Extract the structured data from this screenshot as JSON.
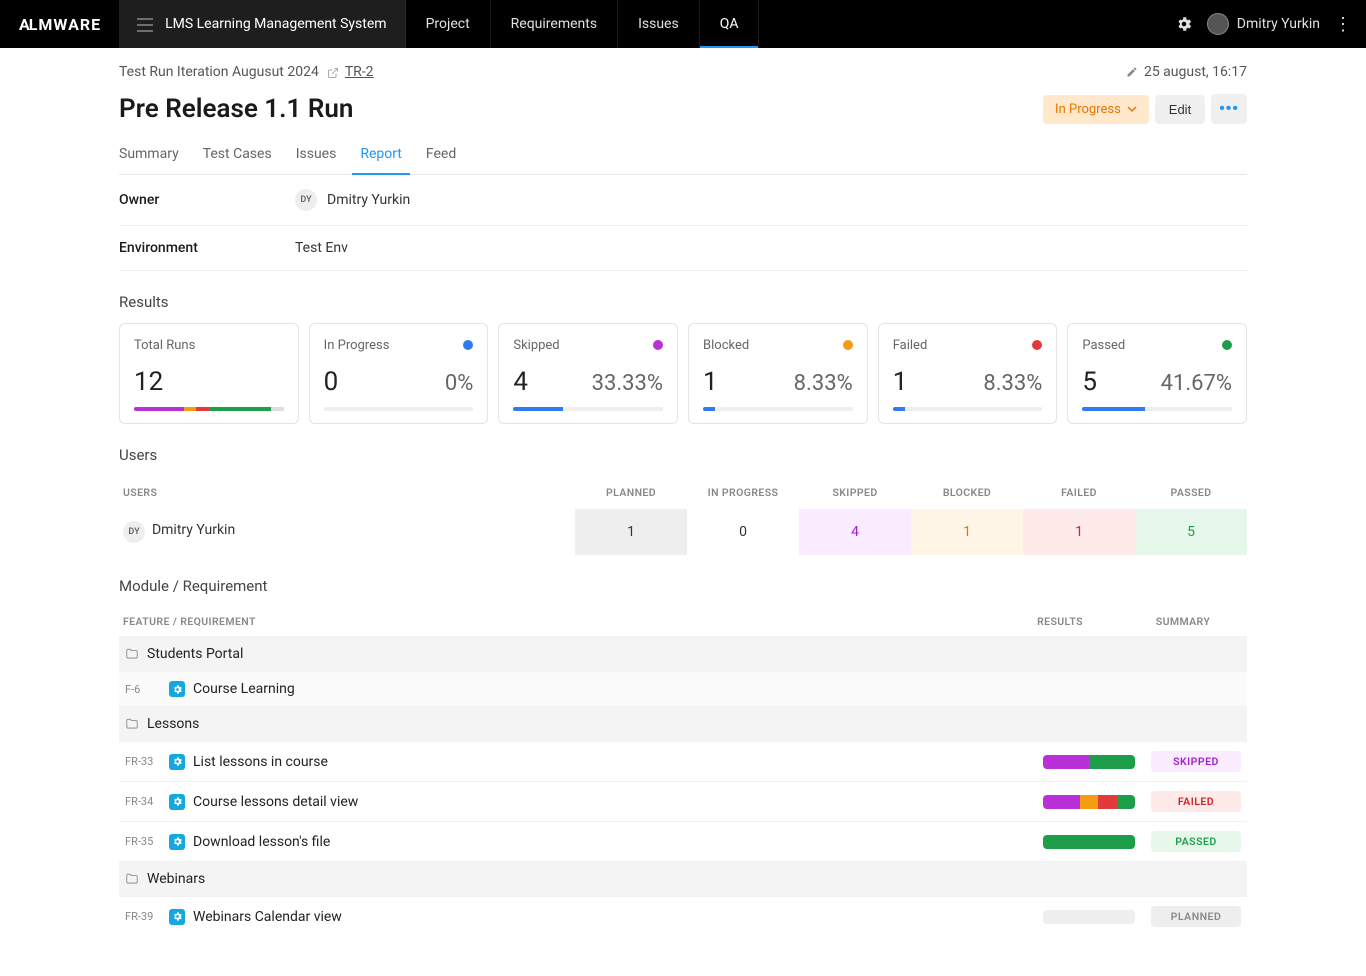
{
  "colors": {
    "inprogress": "#2f7bf3",
    "skipped": "#b930d8",
    "blocked": "#f39c12",
    "failed": "#e23a3a",
    "passed": "#1f9e4a",
    "planned": "#dddddd"
  },
  "nav": {
    "logo": "ALMWARE",
    "project_selector": "LMS Learning Management System",
    "items": [
      "Project",
      "Requirements",
      "Issues",
      "QA"
    ],
    "active_index": 3,
    "user_name": "Dmitry Yurkin"
  },
  "breadcrumb": {
    "text": "Test Run Iteration Augusut 2024",
    "id": "TR-2",
    "date": "25 august, 16:17"
  },
  "header": {
    "title": "Pre Release 1.1 Run",
    "status": "In Progress",
    "edit": "Edit"
  },
  "tabs": {
    "items": [
      "Summary",
      "Test Cases",
      "Issues",
      "Report",
      "Feed"
    ],
    "active_index": 3
  },
  "details": {
    "owner_label": "Owner",
    "owner_initials": "DY",
    "owner_name": "Dmitry Yurkin",
    "env_label": "Environment",
    "env_value": "Test Env"
  },
  "sections": {
    "results": "Results",
    "users": "Users",
    "module": "Module / Requirement"
  },
  "result_cards": [
    {
      "key": "total",
      "label": "Total Runs",
      "value": "12",
      "percent": "",
      "dot": "",
      "bar": [
        [
          "#b930d8",
          33.33
        ],
        [
          "#f39c12",
          8.33
        ],
        [
          "#e23a3a",
          8.33
        ],
        [
          "#1f9e4a",
          41.67
        ],
        [
          "#dddddd",
          8.34
        ]
      ]
    },
    {
      "key": "inprogress",
      "label": "In Progress",
      "value": "0",
      "percent": "0%",
      "dot": "#2f7bf3",
      "bar": [
        [
          "#2f7bf3",
          0
        ],
        [
          "#eeeeee",
          100
        ]
      ]
    },
    {
      "key": "skipped",
      "label": "Skipped",
      "value": "4",
      "percent": "33.33%",
      "dot": "#b930d8",
      "bar": [
        [
          "#2f7bf3",
          33.33
        ],
        [
          "#eeeeee",
          66.67
        ]
      ]
    },
    {
      "key": "blocked",
      "label": "Blocked",
      "value": "1",
      "percent": "8.33%",
      "dot": "#f39c12",
      "bar": [
        [
          "#2f7bf3",
          8.33
        ],
        [
          "#eeeeee",
          91.67
        ]
      ]
    },
    {
      "key": "failed",
      "label": "Failed",
      "value": "1",
      "percent": "8.33%",
      "dot": "#e23a3a",
      "bar": [
        [
          "#2f7bf3",
          8.33
        ],
        [
          "#eeeeee",
          91.67
        ]
      ]
    },
    {
      "key": "passed",
      "label": "Passed",
      "value": "5",
      "percent": "41.67%",
      "dot": "#1f9e4a",
      "bar": [
        [
          "#2f7bf3",
          41.67
        ],
        [
          "#eeeeee",
          58.33
        ]
      ]
    }
  ],
  "users": {
    "columns": [
      "USERS",
      "PLANNED",
      "IN PROGRESS",
      "SKIPPED",
      "BLOCKED",
      "FAILED",
      "PASSED"
    ],
    "rows": [
      {
        "initials": "DY",
        "name": "Dmitry Yurkin",
        "planned": "1",
        "inprogress": "0",
        "skipped": "4",
        "blocked": "1",
        "failed": "1",
        "passed": "5"
      }
    ]
  },
  "module": {
    "columns": {
      "feat": "FEATURE / REQUIREMENT",
      "res": "RESULTS",
      "sum": "SUMMARY"
    },
    "rows": [
      {
        "type": "folder",
        "name": "Students Portal"
      },
      {
        "type": "feature",
        "id": "F-6",
        "name": "Course Learning"
      },
      {
        "type": "folder",
        "name": "Lessons"
      },
      {
        "type": "req",
        "id": "FR-33",
        "name": "List lessons in course",
        "segments": [
          [
            "#b930d8",
            50
          ],
          [
            "#1f9e4a",
            50
          ]
        ],
        "summary": "SKIPPED",
        "pill": "pill-skipped"
      },
      {
        "type": "req",
        "id": "FR-34",
        "name": "Course lessons detail view",
        "segments": [
          [
            "#b930d8",
            40
          ],
          [
            "#f39c12",
            20
          ],
          [
            "#e23a3a",
            20
          ],
          [
            "#1f9e4a",
            20
          ]
        ],
        "summary": "FAILED",
        "pill": "pill-failed"
      },
      {
        "type": "req",
        "id": "FR-35",
        "name": "Download lesson's file",
        "segments": [
          [
            "#1f9e4a",
            100
          ]
        ],
        "summary": "PASSED",
        "pill": "pill-passed"
      },
      {
        "type": "folder",
        "name": "Webinars"
      },
      {
        "type": "req",
        "id": "FR-39",
        "name": "Webinars Calendar view",
        "segments": [
          [
            "#eeeeee",
            100
          ]
        ],
        "summary": "PLANNED",
        "pill": "pill-planned"
      }
    ]
  }
}
